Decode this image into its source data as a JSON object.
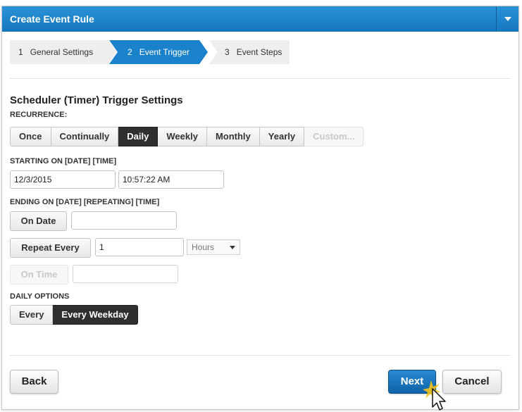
{
  "dialog": {
    "title": "Create Event Rule"
  },
  "steps": [
    {
      "num": "1",
      "label": "General Settings"
    },
    {
      "num": "2",
      "label": "Event Trigger"
    },
    {
      "num": "3",
      "label": "Event Steps"
    }
  ],
  "section": {
    "heading": "Scheduler (Timer) Trigger Settings",
    "recurrence_label": "RECURRENCE:",
    "recurrence_options": [
      "Once",
      "Continually",
      "Daily",
      "Weekly",
      "Monthly",
      "Yearly",
      "Custom..."
    ],
    "recurrence_selected": "Daily",
    "starting_label": "STARTING ON [DATE] [TIME]",
    "start_date": "12/3/2015",
    "start_time": "10:57:22 AM",
    "ending_label": "ENDING ON [DATE] [REPEATING] [TIME]",
    "on_date_label": "On Date",
    "on_date_value": "",
    "repeat_every_label": "Repeat Every",
    "repeat_every_value": "1",
    "repeat_unit": "Hours",
    "on_time_label": "On Time",
    "on_time_value": "",
    "daily_options_label": "DAILY OPTIONS",
    "daily_options": [
      "Every",
      "Every Weekday"
    ],
    "daily_selected": "Every Weekday"
  },
  "footer": {
    "back_label": "Back",
    "next_label": "Next",
    "cancel_label": "Cancel"
  },
  "colors": {
    "accent": "#1a82cb",
    "active_segment": "#2f2f2f"
  }
}
